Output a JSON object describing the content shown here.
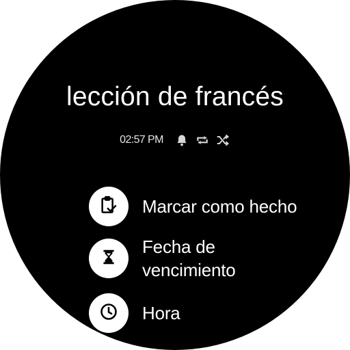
{
  "task": {
    "title": "lección de francés",
    "time": "02:57 PM"
  },
  "status_icons": [
    "bell-icon",
    "repeat-icon",
    "shuffle-icon"
  ],
  "actions": [
    {
      "label": "Marcar como hecho",
      "icon": "clipboard-check-icon"
    },
    {
      "label": "Fecha de vencimiento",
      "icon": "hourglass-icon"
    },
    {
      "label": "Hora",
      "icon": "clock-icon"
    }
  ],
  "colors": {
    "background": "#000000",
    "text": "#ffffff",
    "icon_circle": "#ffffff",
    "icon_glyph": "#000000",
    "meta_text": "#d6d6d6"
  }
}
